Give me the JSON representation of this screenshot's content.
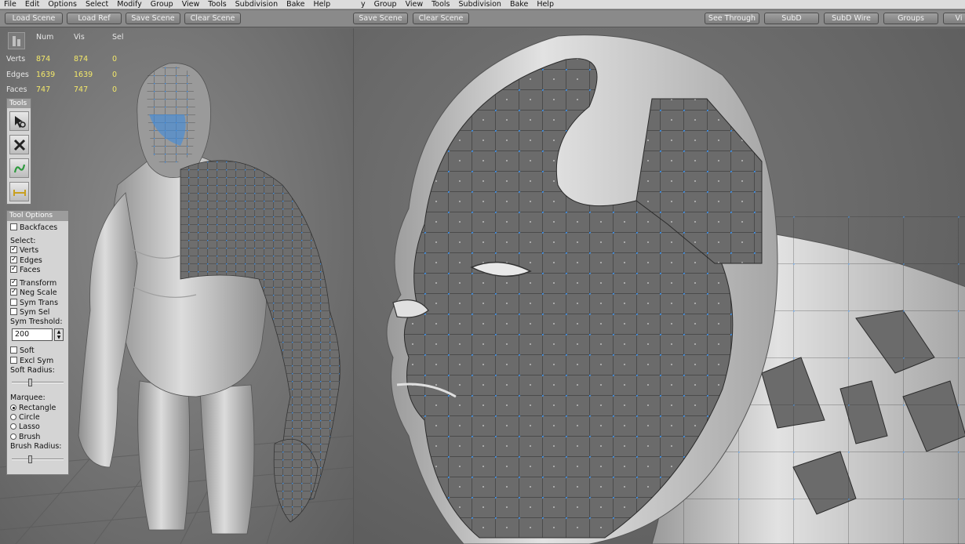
{
  "menu_left": [
    "File",
    "Edit",
    "Options",
    "Select",
    "Modify",
    "Group",
    "View",
    "Tools",
    "Subdivision",
    "Bake",
    "Help"
  ],
  "menu_right": [
    "y",
    "Group",
    "View",
    "Tools",
    "Subdivision",
    "Bake",
    "Help"
  ],
  "toolbar_left": [
    "Load Scene",
    "Load Ref",
    "Save Scene",
    "Clear Scene"
  ],
  "toolbar_right_file": [
    "Save Scene",
    "Clear Scene"
  ],
  "toolbar_right": [
    "See Through",
    "SubD",
    "SubD Wire",
    "Groups",
    "Vi"
  ],
  "stats": {
    "headers": [
      "Num",
      "Vis",
      "Sel"
    ],
    "rows": [
      {
        "label": "Verts",
        "num": "874",
        "vis": "874",
        "sel": "0"
      },
      {
        "label": "Edges",
        "num": "1639",
        "vis": "1639",
        "sel": "0"
      },
      {
        "label": "Faces",
        "num": "747",
        "vis": "747",
        "sel": "0"
      }
    ]
  },
  "tools_title": "Tools",
  "tools_icons": [
    "select-arrow-icon",
    "transform-move-icon",
    "curve-tool-icon",
    "measure-tool-icon"
  ],
  "tool_options": {
    "title": "Tool Options",
    "backfaces": {
      "label": "Backfaces",
      "checked": false
    },
    "select_label": "Select:",
    "select_items": [
      {
        "label": "Verts",
        "checked": true
      },
      {
        "label": "Edges",
        "checked": true
      },
      {
        "label": "Faces",
        "checked": true
      }
    ],
    "transform_items": [
      {
        "label": "Transform",
        "checked": true
      },
      {
        "label": "Neg Scale",
        "checked": true
      },
      {
        "label": "Sym Trans",
        "checked": false
      },
      {
        "label": "Sym Sel",
        "checked": false
      }
    ],
    "sym_threshold_label": "Sym Treshold:",
    "sym_threshold_value": "200",
    "soft_items": [
      {
        "label": "Soft",
        "checked": false
      },
      {
        "label": "Excl Sym",
        "checked": false
      }
    ],
    "soft_radius_label": "Soft Radius:",
    "soft_radius_level": 0.35,
    "marquee_label": "Marquee:",
    "marquee_options": [
      {
        "label": "Rectangle",
        "selected": true
      },
      {
        "label": "Circle",
        "selected": false
      },
      {
        "label": "Lasso",
        "selected": false
      },
      {
        "label": "Brush",
        "selected": false
      }
    ],
    "brush_radius_label": "Brush Radius:",
    "brush_radius_level": 0.35
  },
  "colors": {
    "wire": "#3d8ce0",
    "stat_value": "#f3e86a",
    "mesh_light": "#c9c9c9",
    "mesh_dark": "#6b6b6b"
  }
}
